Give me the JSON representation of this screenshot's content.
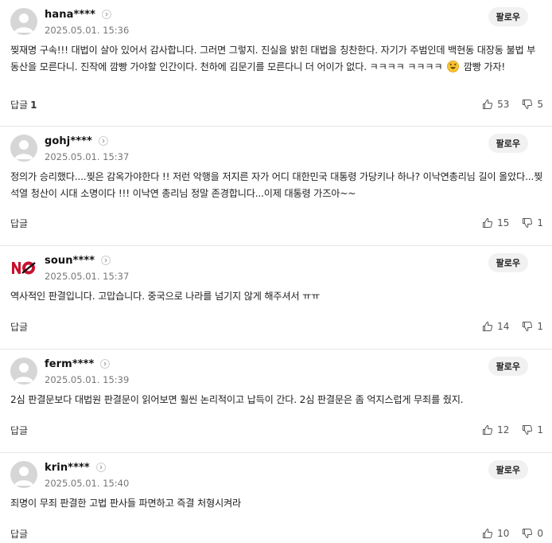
{
  "comments": [
    {
      "nickname": "hana****",
      "date": "2025.05.01. 15:36",
      "follow": "팔로우",
      "text_before_emoji": "찢재명 구속!!! 대법이 살아 있어서 감사합니다. 그러면 그렇지. 진실을 밝힌 대법을 칭찬한다. 자기가 주범인데 백현동 대장동 불법 부동산을 모른다니. 진작에 깜빵 가야할 인간이다. 천하에 김문기를 모른다니 더 어이가 없다. ㅋㅋㅋㅋ ㅋㅋㅋㅋ",
      "text_after_emoji": " 깜빵 가자!",
      "emoji": "laughing-emoji-icon",
      "reply_label": "답글",
      "reply_count": "1",
      "likes": "53",
      "dislikes": "5"
    },
    {
      "nickname": "gohj****",
      "date": "2025.05.01. 15:37",
      "follow": "팔로우",
      "text": "정의가 승리했다....찢은 감옥가야한다 !! 저런 악행을 저지른 자가 어디 대한민국 대통령 가당키나 하나? 이낙연총리님 길이 올았다...찢석열 청산이 시대 소명이다 !!! 이낙연 총리님 정말 존경합니다...이제 대통령 가즈아~~",
      "reply_label": "답글",
      "likes": "15",
      "dislikes": "1"
    },
    {
      "nickname": "soun****",
      "date": "2025.05.01. 15:37",
      "follow": "팔로우",
      "text": "역사적인 판결입니다. 고맙습니다. 중국으로 나라를 넘기지 않게 해주셔서 ㅠㅠ",
      "reply_label": "답글",
      "likes": "14",
      "dislikes": "1"
    },
    {
      "nickname": "ferm****",
      "date": "2025.05.01. 15:39",
      "follow": "팔로우",
      "text": "2심 판결문보다 대법원 판결문이 읽어보면 훨씬 논리적이고 납득이 간다. 2심 판결문은 좀 억지스럽게 무죄를 줬지.",
      "reply_label": "답글",
      "likes": "12",
      "dislikes": "1"
    },
    {
      "nickname": "krin****",
      "date": "2025.05.01. 15:40",
      "follow": "팔로우",
      "text": "죄명이 무죄 판결한 고법 판사들 파면하고 즉결 처형시켜라",
      "reply_label": "답글",
      "likes": "10",
      "dislikes": "0"
    }
  ],
  "icons": {
    "profile": "profile-icon",
    "chevron": "chevron-right-icon",
    "like": "thumbs-up-icon",
    "dislike": "thumbs-down-icon",
    "brand_avatar": "no-logo-icon"
  },
  "colors": {
    "follow_bg": "#f1f1f1",
    "avatar_bg": "#d6d6d6",
    "divider": "#e6e6e6"
  }
}
